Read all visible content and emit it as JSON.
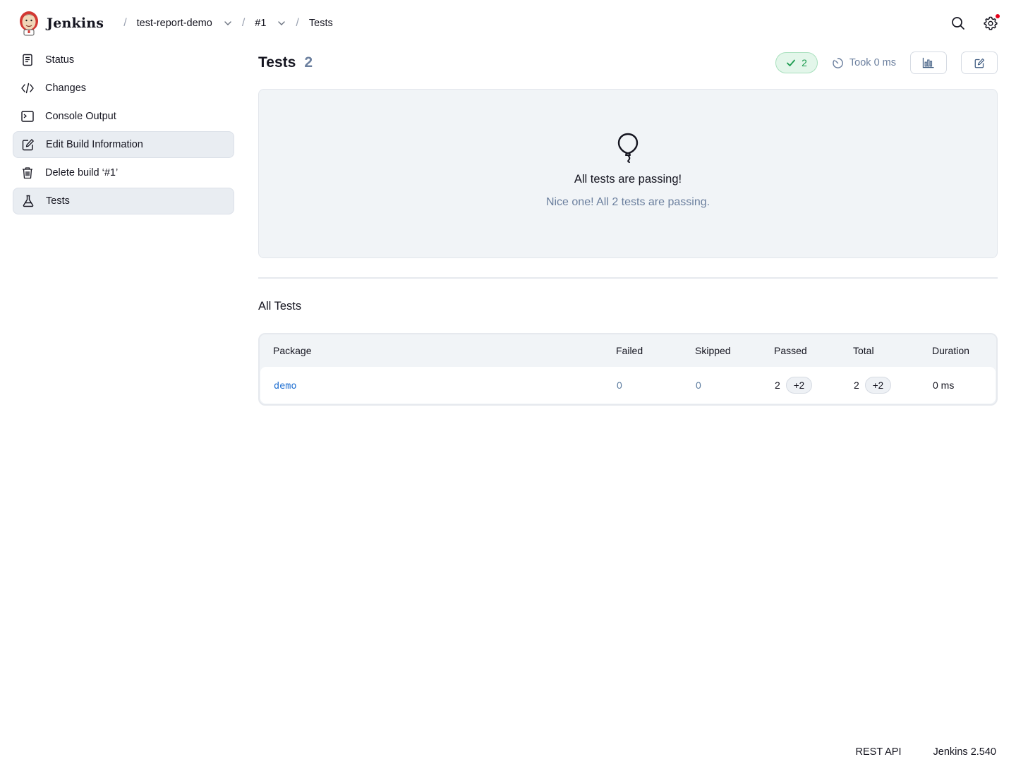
{
  "header": {
    "brand": "Jenkins",
    "breadcrumb": [
      {
        "label": "test-report-demo",
        "has_menu": true
      },
      {
        "label": "#1",
        "has_menu": true
      },
      {
        "label": "Tests",
        "has_menu": false
      }
    ],
    "separator": "/",
    "icons": [
      "search-icon",
      "gear-icon"
    ],
    "notification_color": "#e5001a"
  },
  "sidebar": {
    "items": [
      {
        "label": "Status",
        "icon": "document-icon",
        "active": false
      },
      {
        "label": "Changes",
        "icon": "code-icon",
        "active": false
      },
      {
        "label": "Console Output",
        "icon": "terminal-icon",
        "active": false
      },
      {
        "label": "Edit Build Information",
        "icon": "edit-icon",
        "active": true
      },
      {
        "label": "Delete build ‘#1’",
        "icon": "trash-icon",
        "active": false
      },
      {
        "label": "Tests",
        "icon": "flask-icon",
        "active": true
      }
    ]
  },
  "main": {
    "title": "Tests",
    "count": "2",
    "passed_badge": "2",
    "took": "Took 0 ms",
    "actions": [
      "chart-icon",
      "edit-icon"
    ],
    "empty_state": {
      "title": "All tests are passing!",
      "subtitle": "Nice one! All 2 tests are passing."
    },
    "section_title": "All Tests",
    "table": {
      "columns": [
        "Package",
        "Failed",
        "Skipped",
        "Passed",
        "Total",
        "Duration"
      ],
      "rows": [
        {
          "package": "demo",
          "failed": "0",
          "skipped": "0",
          "passed": "2",
          "passed_delta": "+2",
          "total": "2",
          "total_delta": "+2",
          "duration": "0 ms"
        }
      ]
    }
  },
  "footer": {
    "rest_api": "REST API",
    "version": "Jenkins 2.540"
  },
  "colors": {
    "accent_link": "#1f6fd1",
    "success": "#1c9b4f",
    "muted": "#6b7f9e"
  }
}
